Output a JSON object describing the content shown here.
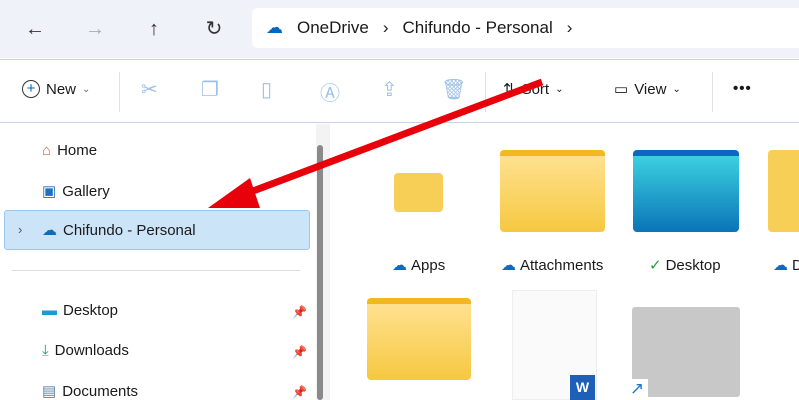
{
  "nav": {
    "back": "←",
    "forward": "→",
    "up": "↑",
    "refresh": "↻"
  },
  "breadcrumb": [
    "OneDrive",
    "Chifundo - Personal"
  ],
  "toolbar": {
    "new": "New",
    "sort": "Sort",
    "view": "View",
    "more": "•••"
  },
  "sidebar": {
    "items": [
      {
        "label": "Home"
      },
      {
        "label": "Gallery"
      },
      {
        "label": "Chifundo - Personal"
      }
    ],
    "quick": [
      {
        "label": "Desktop"
      },
      {
        "label": "Downloads"
      },
      {
        "label": "Documents"
      }
    ]
  },
  "files": [
    {
      "name": "Apps",
      "status": "cloud"
    },
    {
      "name": "Attachments",
      "status": "cloud"
    },
    {
      "name": "Desktop",
      "status": "synced"
    },
    {
      "name": "D",
      "status": "cloud"
    }
  ],
  "colors": {
    "accent": "#0067c0",
    "arrow": "#e8000b",
    "folder": "#f8cf56"
  }
}
